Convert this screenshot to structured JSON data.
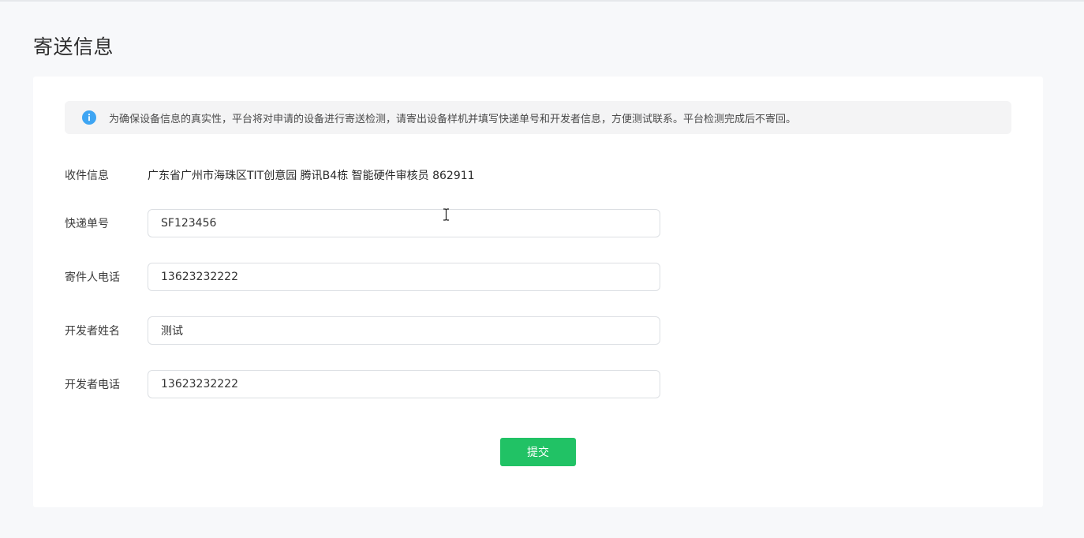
{
  "page": {
    "title": "寄送信息"
  },
  "notice": {
    "icon": "info-icon",
    "text": "为确保设备信息的真实性，平台将对申请的设备进行寄送检测，请寄出设备样机并填写快递单号和开发者信息，方便测试联系。平台检测完成后不寄回。"
  },
  "form": {
    "receiver": {
      "label": "收件信息",
      "value": "广东省广州市海珠区TIT创意园 腾讯B4栋 智能硬件审核员 862911"
    },
    "tracking_number": {
      "label": "快递单号",
      "value": "SF123456"
    },
    "sender_phone": {
      "label": "寄件人电话",
      "value": "13623232222"
    },
    "developer_name": {
      "label": "开发者姓名",
      "value": "测试"
    },
    "developer_phone": {
      "label": "开发者电话",
      "value": "13623232222"
    }
  },
  "actions": {
    "submit_label": "提交"
  },
  "colors": {
    "accent_green": "#21c265",
    "info_blue": "#3ea5f3"
  }
}
